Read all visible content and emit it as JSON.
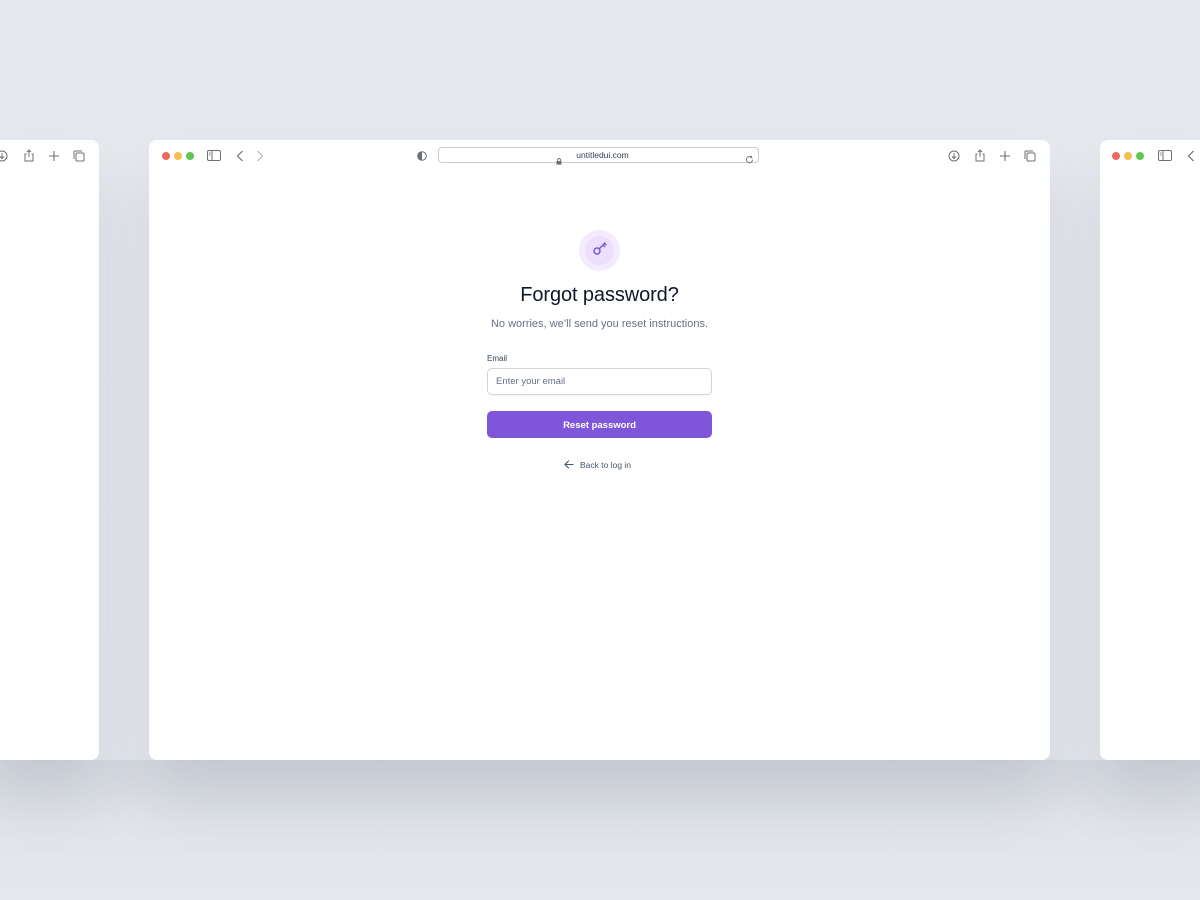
{
  "browser": {
    "url": "untitledui.com",
    "traffic_light_colors": {
      "close": "#ec6a5e",
      "minimize": "#f4bf4f",
      "maximize": "#61c554"
    }
  },
  "page": {
    "icon": "key-icon",
    "title": "Forgot password?",
    "subtitle": "No worries, we’ll send you reset instructions.",
    "email_label": "Email",
    "email_placeholder": "Enter your email",
    "email_value": "",
    "reset_button_label": "Reset password",
    "back_link_label": "Back to log in"
  },
  "colors": {
    "primary": "#7f56d9",
    "icon_badge": "#f4ebff",
    "background": "#e5e8ed"
  }
}
